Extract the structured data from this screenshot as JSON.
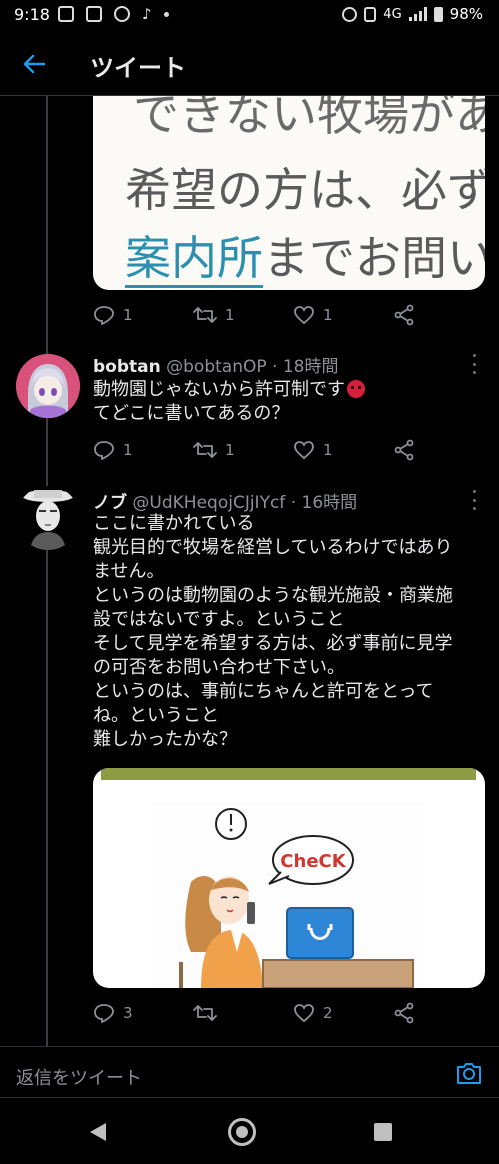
{
  "status_bar": {
    "time": "9:18",
    "network": "4G",
    "battery": "98%"
  },
  "header": {
    "title": "ツイート"
  },
  "top_image": {
    "line1": "できない牧場があ",
    "line2": "希望の方は、必ず",
    "line3_link": "案内所",
    "line3_rest": "までお問い"
  },
  "top_actions": {
    "reply_count": "1",
    "retweet_count": "1",
    "like_count": "1"
  },
  "tweet1": {
    "name": "bobtan",
    "handle": "@bobtanOP",
    "time": "18時間",
    "lines": [
      "動物園じゃないから許可制です",
      "てどこに書いてあるの？"
    ],
    "reply_count": "1",
    "retweet_count": "1",
    "like_count": "1"
  },
  "tweet2": {
    "name": "ノブ",
    "handle": "@UdKHeqojCJjIYcf",
    "time": "16時間",
    "lines": [
      "ここに書かれている",
      "観光目的で牧場を経営しているわけではあり",
      "ません。",
      "というのは動物園のような観光施設・商業施",
      "設ではないですよ。ということ",
      "そして見学を希望する方は、必ず事前に見学",
      "の可否をお問い合わせ下さい。",
      "というのは、事前にちゃんと許可をとって",
      "ね。ということ",
      "難しかったかな？"
    ],
    "image_text": "CheCK",
    "reply_count": "3",
    "retweet_count": "",
    "like_count": "2"
  },
  "reply_bar": {
    "placeholder": "返信をツイート"
  },
  "colors": {
    "accent": "#1d9bf0",
    "background": "#000000",
    "muted": "#8b9196"
  }
}
